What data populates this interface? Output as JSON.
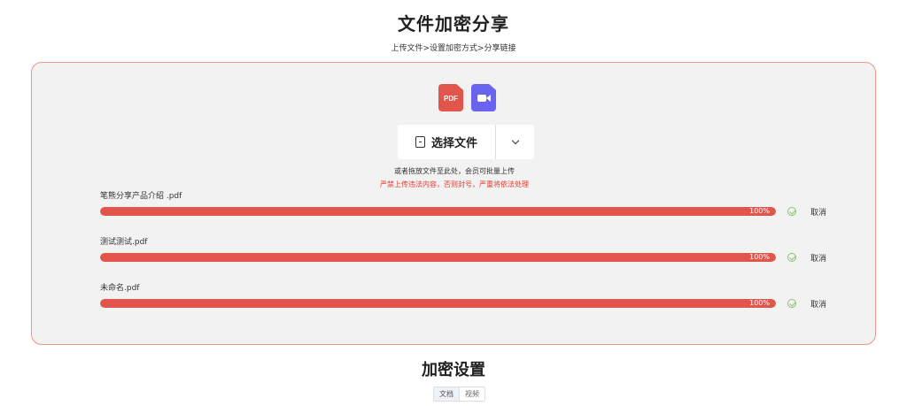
{
  "header": {
    "title": "文件加密分享",
    "steps": "上传文件>设置加密方式>分享链接"
  },
  "upload": {
    "file_type_icons": [
      {
        "icon": "pdf-file-icon",
        "label": "PDF",
        "color": "#e2554a"
      },
      {
        "icon": "video-file-icon",
        "color": "#6a63f0"
      }
    ],
    "select_button_label": "选择文件",
    "hint": "或者拖放文件至此处，会员可批量上传",
    "warning": "严禁上传违法内容，否则封号，严重将依法处理",
    "warning_color": "#e03a2f",
    "border_color": "#e8998a"
  },
  "files": [
    {
      "name": "笔熊分享产品介绍 .pdf",
      "progress": 100,
      "progress_text": "100%",
      "action": "取消"
    },
    {
      "name": "测试测试.pdf",
      "progress": 100,
      "progress_text": "100%",
      "action": "取消"
    },
    {
      "name": "未命名.pdf",
      "progress": 100,
      "progress_text": "100%",
      "action": "取消"
    }
  ],
  "encryption": {
    "title": "加密设置",
    "tabs": [
      {
        "label": "文档",
        "active": true
      },
      {
        "label": "视频",
        "active": false
      }
    ]
  },
  "colors": {
    "progress": "#e2554a",
    "success": "#8cc26e"
  }
}
